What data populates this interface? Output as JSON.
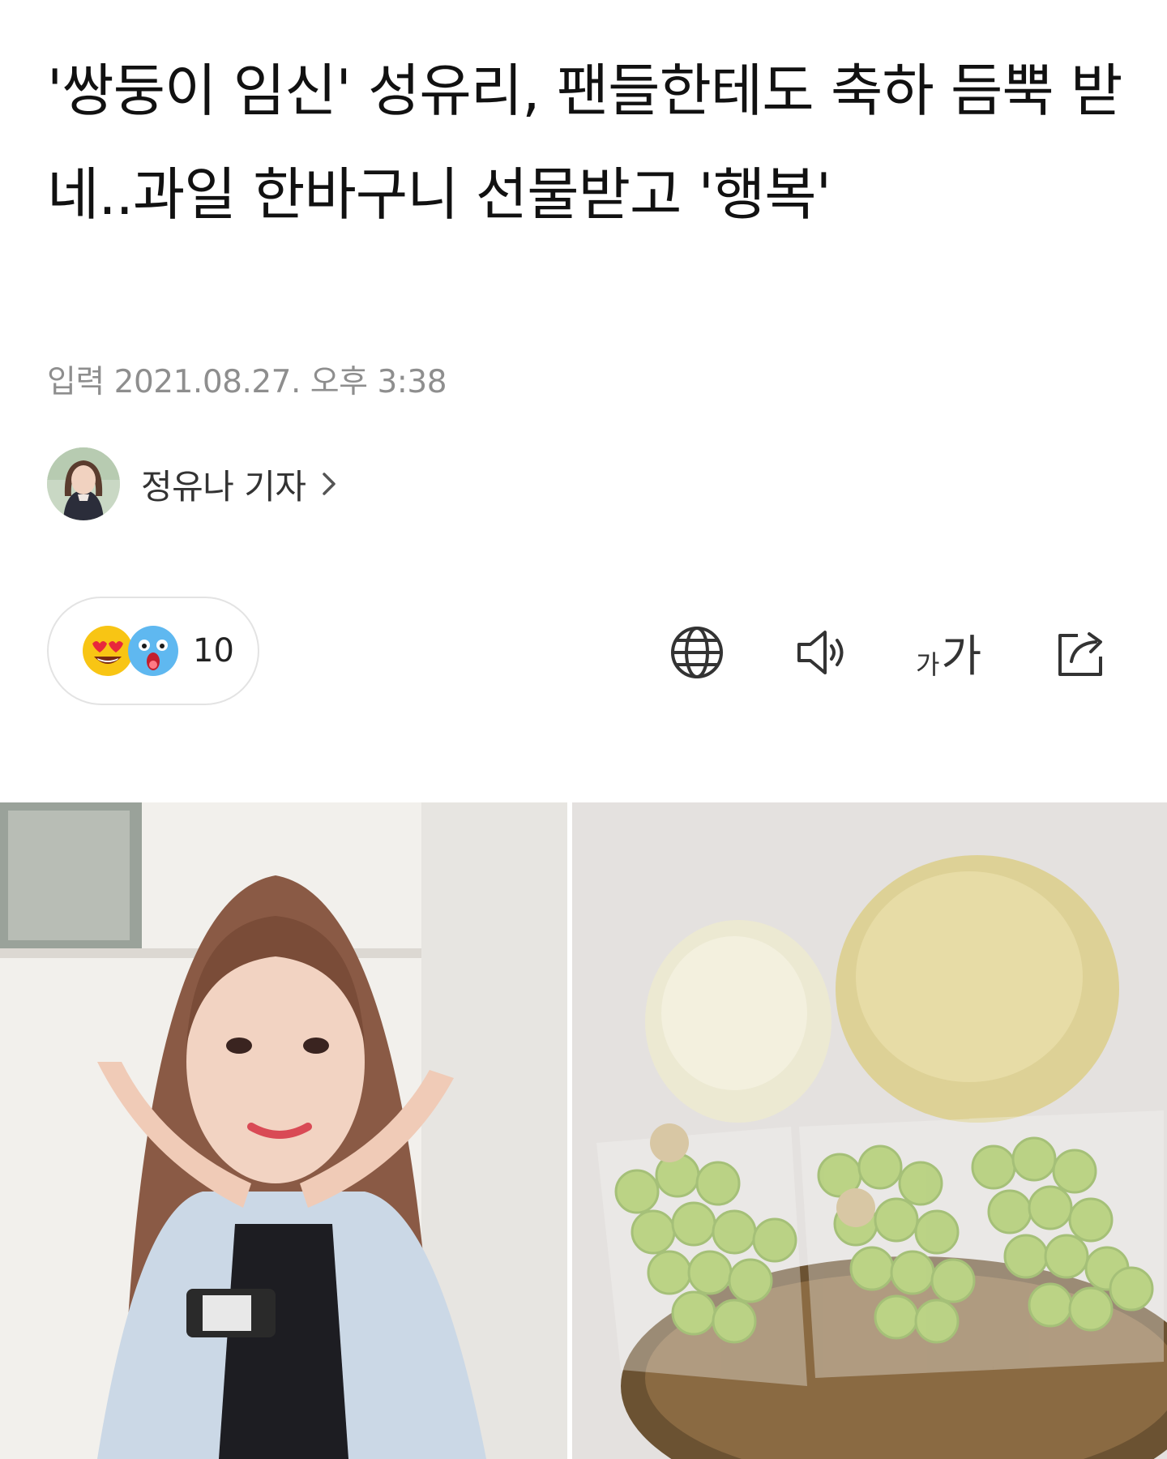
{
  "article": {
    "headline": "'쌍둥이 임신' 성유리, 팬들한테도 축하 듬뿍 받네..과일 한바구니 선물받고 '행복'",
    "published_label": "입력",
    "published_date": "2021.08.27.",
    "published_time": "오후 3:38"
  },
  "reporter": {
    "name": "정유나 기자"
  },
  "reactions": {
    "count": "10",
    "icons": [
      "heart-eyes-emoji-icon",
      "shocked-emoji-icon"
    ]
  },
  "toolbar": {
    "icons": [
      "globe-icon",
      "speaker-icon",
      "font-size-icon",
      "share-icon"
    ],
    "font_small": "가",
    "font_big": "가"
  },
  "colors": {
    "text": "#111111",
    "meta": "#8e8e8e",
    "pill_border": "#e3e3e3",
    "emoji_yellow": "#f8c514",
    "emoji_blue": "#5fb8f0"
  }
}
